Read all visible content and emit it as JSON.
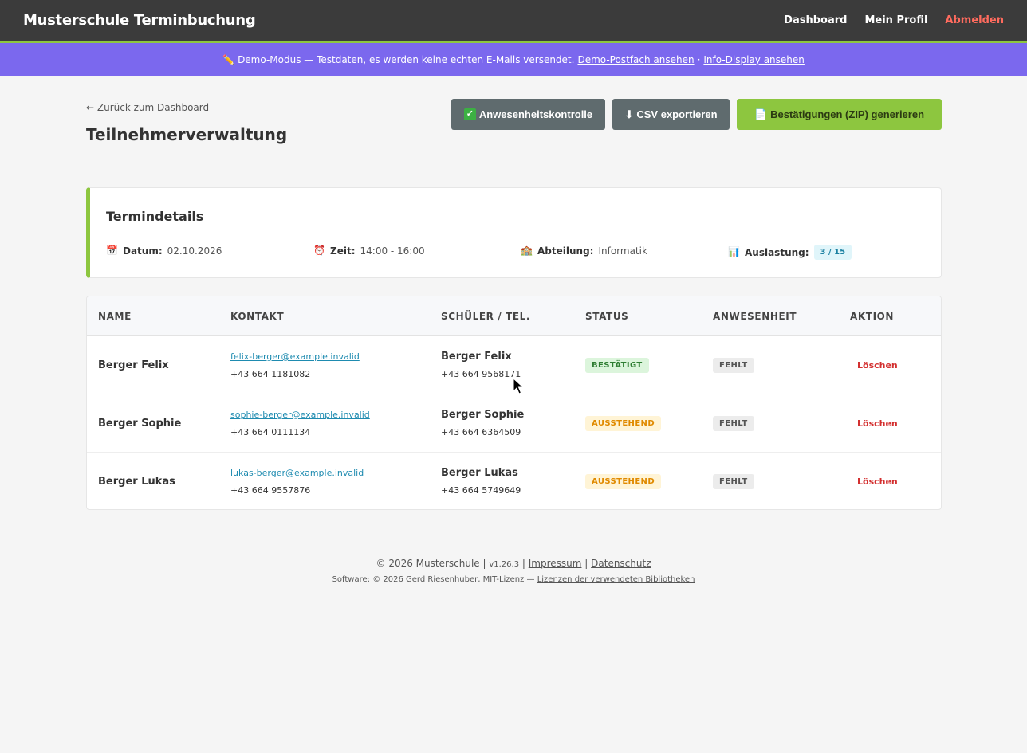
{
  "header": {
    "brand": "Musterschule Terminbuchung",
    "nav": {
      "dashboard": "Dashboard",
      "profile": "Mein Profil",
      "logout": "Abmelden"
    }
  },
  "demo_banner": {
    "icon": "pencil-icon",
    "text": "Demo-Modus — Testdaten, es werden keine echten E-Mails versendet.",
    "link1": "Demo-Postfach ansehen",
    "separator": "·",
    "link2": "Info-Display ansehen"
  },
  "page": {
    "back_link": "← Zurück zum Dashboard",
    "title": "Teilnehmerverwaltung"
  },
  "actions": {
    "attendance": "Anwesenheitskontrolle",
    "csv": "CSV exportieren",
    "zip": "Bestätigungen (ZIP) generieren"
  },
  "details": {
    "title": "Termindetails",
    "date_label": "Datum:",
    "date_value": "02.10.2026",
    "time_label": "Zeit:",
    "time_value": "14:00 - 16:00",
    "dept_label": "Abteilung:",
    "dept_value": "Informatik",
    "load_label": "Auslastung:",
    "load_value": "3 / 15"
  },
  "table": {
    "headers": [
      "NAME",
      "KONTAKT",
      "SCHÜLER / TEL.",
      "STATUS",
      "ANWESENHEIT",
      "AKTION"
    ],
    "rows": [
      {
        "name": "Berger Felix",
        "email": "felix-berger@example.invalid",
        "phone": "+43 664 1181082",
        "student": "Berger Felix",
        "student_phone": "+43 664 9568171",
        "status": "BESTÄTIGT",
        "attendance": "FEHLT",
        "action": "Löschen"
      },
      {
        "name": "Berger Sophie",
        "email": "sophie-berger@example.invalid",
        "phone": "+43 664 0111134",
        "student": "Berger Sophie",
        "student_phone": "+43 664 6364509",
        "status": "AUSSTEHEND",
        "attendance": "FEHLT",
        "action": "Löschen"
      },
      {
        "name": "Berger Lukas",
        "email": "lukas-berger@example.invalid",
        "phone": "+43 664 9557876",
        "student": "Berger Lukas",
        "student_phone": "+43 664 5749649",
        "status": "AUSSTEHEND",
        "attendance": "FEHLT",
        "action": "Löschen"
      }
    ]
  },
  "footer": {
    "copyright": "© 2026 Musterschule",
    "version": "v1.26.3",
    "impressum": "Impressum",
    "datenschutz": "Datenschutz",
    "software": "Software: © 2026 Gerd Riesenhuber, MIT-Lizenz —",
    "licenses": "Lizenzen der verwendeten Bibliotheken"
  },
  "colors": {
    "accent": "#8dc63f",
    "banner": "#7b68ee",
    "header": "#3b3b3b",
    "danger": "#d32f2f"
  }
}
